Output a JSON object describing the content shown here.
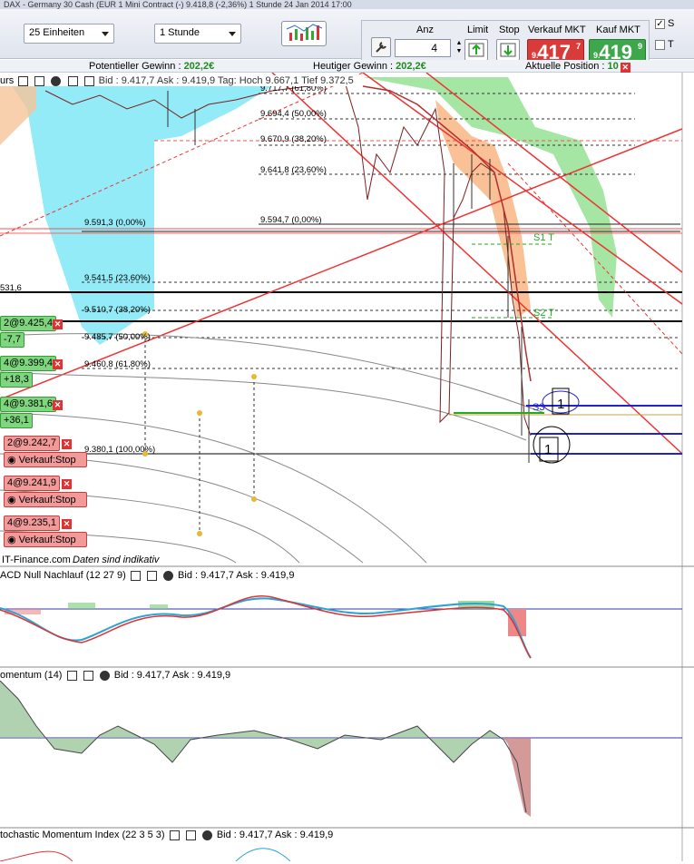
{
  "window": {
    "title": "DAX - Germany 30 Cash (EUR 1 Mini Contract (-)   9.418,8 (-2,36%)   1 Stunde  24 Jan 2014 17:00"
  },
  "toolbar": {
    "units_select": "25 Einheiten",
    "timeframe_select": "1 Stunde",
    "anz_label": "Anz",
    "qty_value": "4",
    "limit_label": "Limit",
    "stop_label": "Stop",
    "sell_label": "Verkauf MKT",
    "buy_label": "Kauf MKT",
    "sell_price_prefix": "9.",
    "sell_price_main": "417",
    "sell_price_sup": "7",
    "buy_price_prefix": "9.",
    "buy_price_main": "419",
    "buy_price_sup": "9",
    "check_s": "S",
    "check_t": "T"
  },
  "status": {
    "potential_label": "Potentieller Gewinn : ",
    "potential_value": "202,2€",
    "today_label": "Heutiger Gewinn : ",
    "today_value": "202,2€",
    "position_label": "Aktuelle Position : ",
    "position_value": "10"
  },
  "main_chart": {
    "header_left": "urs",
    "header_text": "Bid : 9.417,7   Ask : 9.419,9   Tag: Hoch 9.667,1   Tief 9.372,5",
    "fib_labels": [
      "9.717,7 (61,80%)",
      "9.694,4 (50,00%)",
      "9.670,9 (38,20%)",
      "9.641,8 (23,60%)",
      "9.594,7 (0,00%)",
      "9.591,3 (0,00%)",
      "9.541,5 (23,60%)",
      "9.510,7 (38,20%)",
      "9.485,7 (50,00%)",
      "9.460,8 (61,80%)",
      "9.380,1 (100,00%)"
    ],
    "s1": "S1 T",
    "s2": "S2 T",
    "s3": "S3",
    "box_label_1": "1",
    "box_label_2": "1",
    "left_value_531": "531,6",
    "watermark": "IT-Finance.com",
    "indicative": "Daten sind indikativ"
  },
  "orders": [
    {
      "text": "2@9.425,4",
      "type": "buy"
    },
    {
      "text": "-7,7",
      "type": "sell"
    },
    {
      "text": "4@9.399,4",
      "type": "buy"
    },
    {
      "text": "+18,3",
      "type": "buy"
    },
    {
      "text": "4@9.381,6",
      "type": "buy"
    },
    {
      "text": "+36,1",
      "type": "buy"
    },
    {
      "text": "2@9.242,7",
      "type": "sell"
    },
    {
      "text": "Verkauf:Stop",
      "type": "sell"
    },
    {
      "text": "4@9.241,9",
      "type": "sell"
    },
    {
      "text": "Verkauf:Stop",
      "type": "sell"
    },
    {
      "text": "4@9.235,1",
      "type": "sell"
    },
    {
      "text": "Verkauf:Stop",
      "type": "sell"
    }
  ],
  "macd_panel": {
    "title": "ACD Null Nachlauf (12 27 9)",
    "bidask": "Bid : 9.417,7   Ask : 9.419,9"
  },
  "momentum_panel": {
    "title": "omentum (14)",
    "bidask": "Bid : 9.417,7   Ask : 9.419,9"
  },
  "stoch_panel": {
    "title": "tochastic Momentum Index (22 3 5 3)",
    "bidask": "Bid : 9.417,7   Ask : 9.419,9"
  },
  "colors": {
    "sell": "#d93b3b",
    "buy": "#3fa74b",
    "cloud_green": "#9be39b",
    "cloud_cyan": "#7fe8f5"
  }
}
